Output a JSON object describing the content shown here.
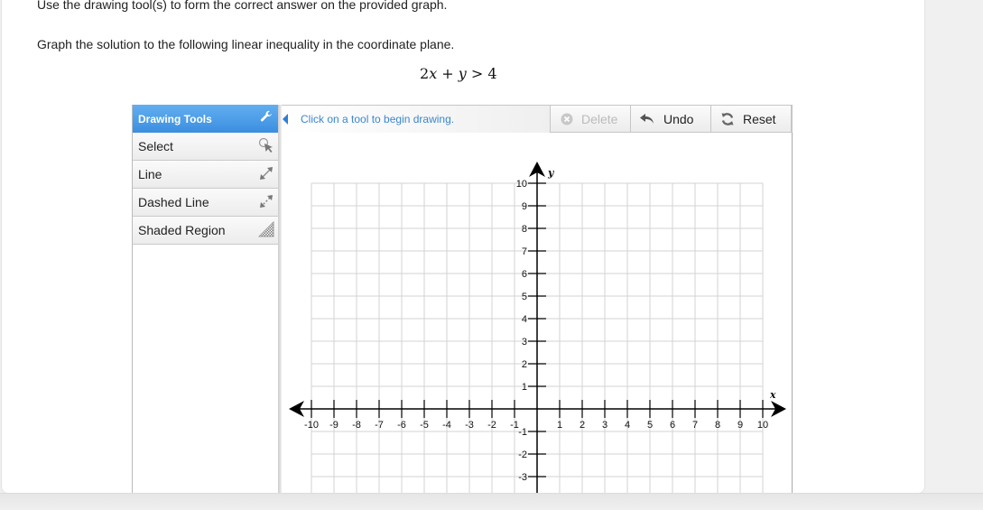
{
  "instructions": "Use the drawing tool(s) to form the correct answer on the provided graph.",
  "question": "Graph the solution to the following linear inequality in the coordinate plane.",
  "inequality": {
    "parts": [
      "2",
      "x",
      " + ",
      "y",
      " > ",
      "4"
    ],
    "text": "2x + y > 4"
  },
  "tools_panel": {
    "title": "Drawing Tools",
    "title_icon": "wrench-icon",
    "items": [
      {
        "label": "Select",
        "icon": "select-pointer-icon"
      },
      {
        "label": "Line",
        "icon": "line-arrows-icon"
      },
      {
        "label": "Dashed Line",
        "icon": "dashed-line-arrows-icon"
      },
      {
        "label": "Shaded Region",
        "icon": "shaded-region-icon"
      }
    ]
  },
  "toolbar": {
    "hint": "Click on a tool to begin drawing.",
    "delete_label": "Delete",
    "delete_enabled": false,
    "undo_label": "Undo",
    "reset_label": "Reset"
  },
  "graph": {
    "x_axis_label": "x",
    "y_axis_label": "y",
    "x_range": [
      -10,
      10
    ],
    "y_range_visible": [
      -3,
      10
    ],
    "grid_step": 1,
    "x_tick_labels": [
      "-10",
      "-9",
      "-8",
      "-7",
      "-6",
      "-5",
      "-4",
      "-3",
      "-2",
      "-1",
      "1",
      "2",
      "3",
      "4",
      "5",
      "6",
      "7",
      "8",
      "9",
      "10"
    ],
    "y_tick_labels": [
      "10",
      "9",
      "8",
      "7",
      "6",
      "5",
      "4",
      "3",
      "2",
      "1",
      "-1",
      "-2",
      "-3"
    ],
    "colors": {
      "grid": "#d3d3d3",
      "axis": "#000000"
    }
  }
}
